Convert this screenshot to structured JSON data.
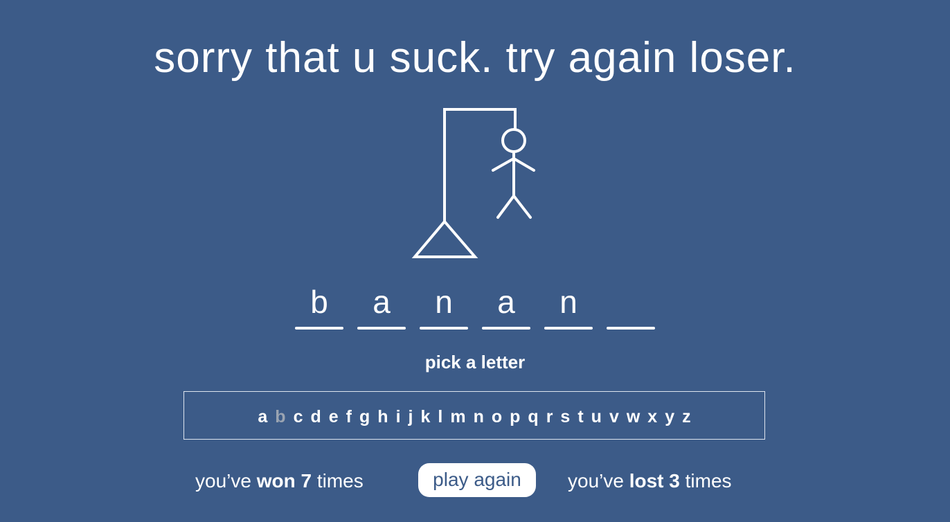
{
  "headline": "sorry that u suck. try again loser.",
  "word_slots": [
    "b",
    "a",
    "n",
    "a",
    "n",
    ""
  ],
  "prompt": "pick a letter",
  "alphabet": [
    {
      "ch": "a",
      "used": false
    },
    {
      "ch": "b",
      "used": true
    },
    {
      "ch": "c",
      "used": false
    },
    {
      "ch": "d",
      "used": false
    },
    {
      "ch": "e",
      "used": false
    },
    {
      "ch": "f",
      "used": false
    },
    {
      "ch": "g",
      "used": false
    },
    {
      "ch": "h",
      "used": false
    },
    {
      "ch": "i",
      "used": false
    },
    {
      "ch": "j",
      "used": false
    },
    {
      "ch": "k",
      "used": false
    },
    {
      "ch": "l",
      "used": false
    },
    {
      "ch": "m",
      "used": false
    },
    {
      "ch": "n",
      "used": false
    },
    {
      "ch": "o",
      "used": false
    },
    {
      "ch": "p",
      "used": false
    },
    {
      "ch": "q",
      "used": false
    },
    {
      "ch": "r",
      "used": false
    },
    {
      "ch": "s",
      "used": false
    },
    {
      "ch": "t",
      "used": false
    },
    {
      "ch": "u",
      "used": false
    },
    {
      "ch": "v",
      "used": false
    },
    {
      "ch": "w",
      "used": false
    },
    {
      "ch": "x",
      "used": false
    },
    {
      "ch": "y",
      "used": false
    },
    {
      "ch": "z",
      "used": false
    }
  ],
  "stats": {
    "won_prefix": "you’ve",
    "won_label": "won 7",
    "won_suffix": "times",
    "lost_prefix": "you’ve",
    "lost_label": "lost 3",
    "lost_suffix": "times"
  },
  "play_again_label": "play again",
  "colors": {
    "background": "#3c5b88",
    "foreground": "#ffffff",
    "used_letter": "#9aa4b2"
  }
}
